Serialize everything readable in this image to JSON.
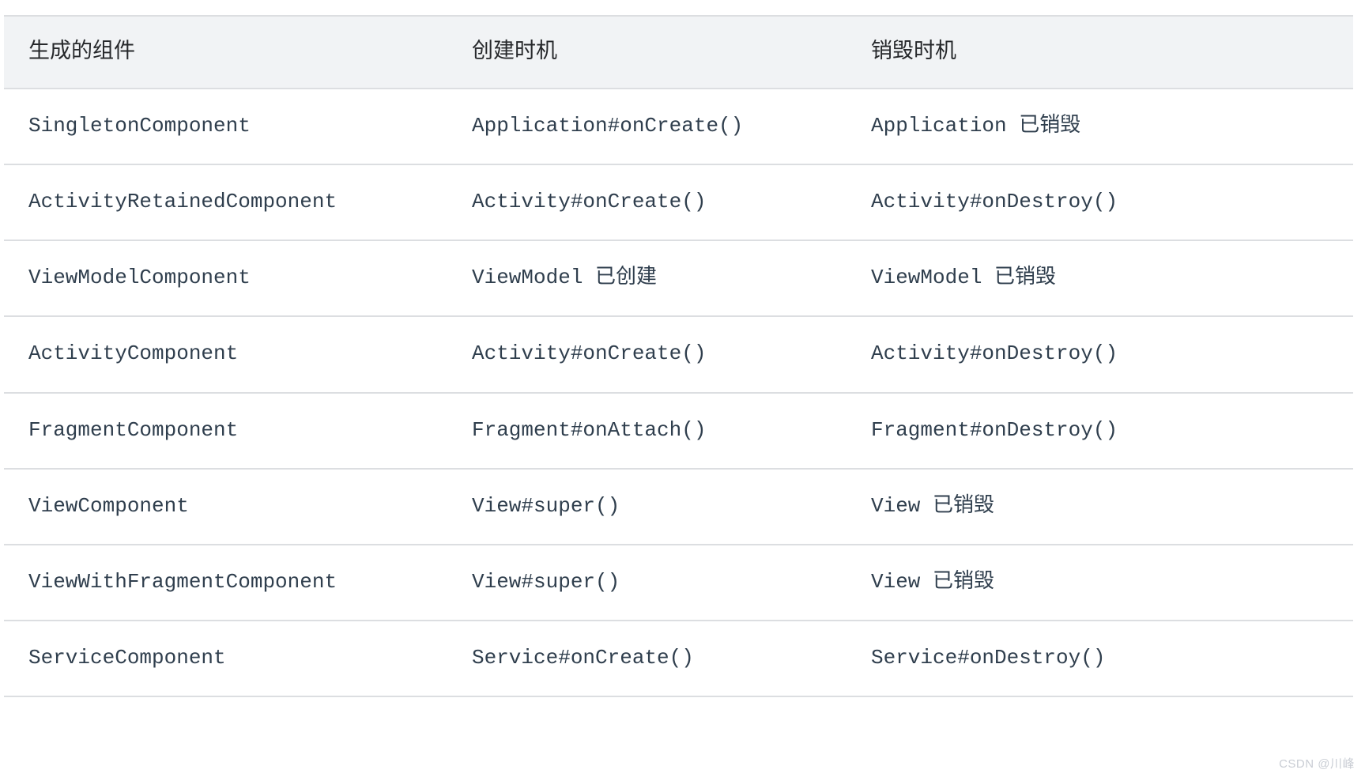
{
  "table": {
    "headers": [
      "生成的组件",
      "创建时机",
      "销毁时机"
    ],
    "rows": [
      {
        "component": "SingletonComponent",
        "created": "Application#onCreate()",
        "destroyed": "Application 已销毁"
      },
      {
        "component": "ActivityRetainedComponent",
        "created": "Activity#onCreate()",
        "destroyed": "Activity#onDestroy()"
      },
      {
        "component": "ViewModelComponent",
        "created": "ViewModel 已创建",
        "destroyed": "ViewModel 已销毁"
      },
      {
        "component": "ActivityComponent",
        "created": "Activity#onCreate()",
        "destroyed": "Activity#onDestroy()"
      },
      {
        "component": "FragmentComponent",
        "created": "Fragment#onAttach()",
        "destroyed": "Fragment#onDestroy()"
      },
      {
        "component": "ViewComponent",
        "created": "View#super()",
        "destroyed": "View 已销毁"
      },
      {
        "component": "ViewWithFragmentComponent",
        "created": "View#super()",
        "destroyed": "View 已销毁"
      },
      {
        "component": "ServiceComponent",
        "created": "Service#onCreate()",
        "destroyed": "Service#onDestroy()"
      }
    ]
  },
  "watermark": "CSDN @川峰",
  "colors": {
    "header_background": "#f1f3f5",
    "border": "#dcdee1",
    "header_text": "#26282b",
    "cell_text": "#2f3e4d",
    "watermark_text": "#c9cdd4",
    "page_background": "#ffffff"
  }
}
